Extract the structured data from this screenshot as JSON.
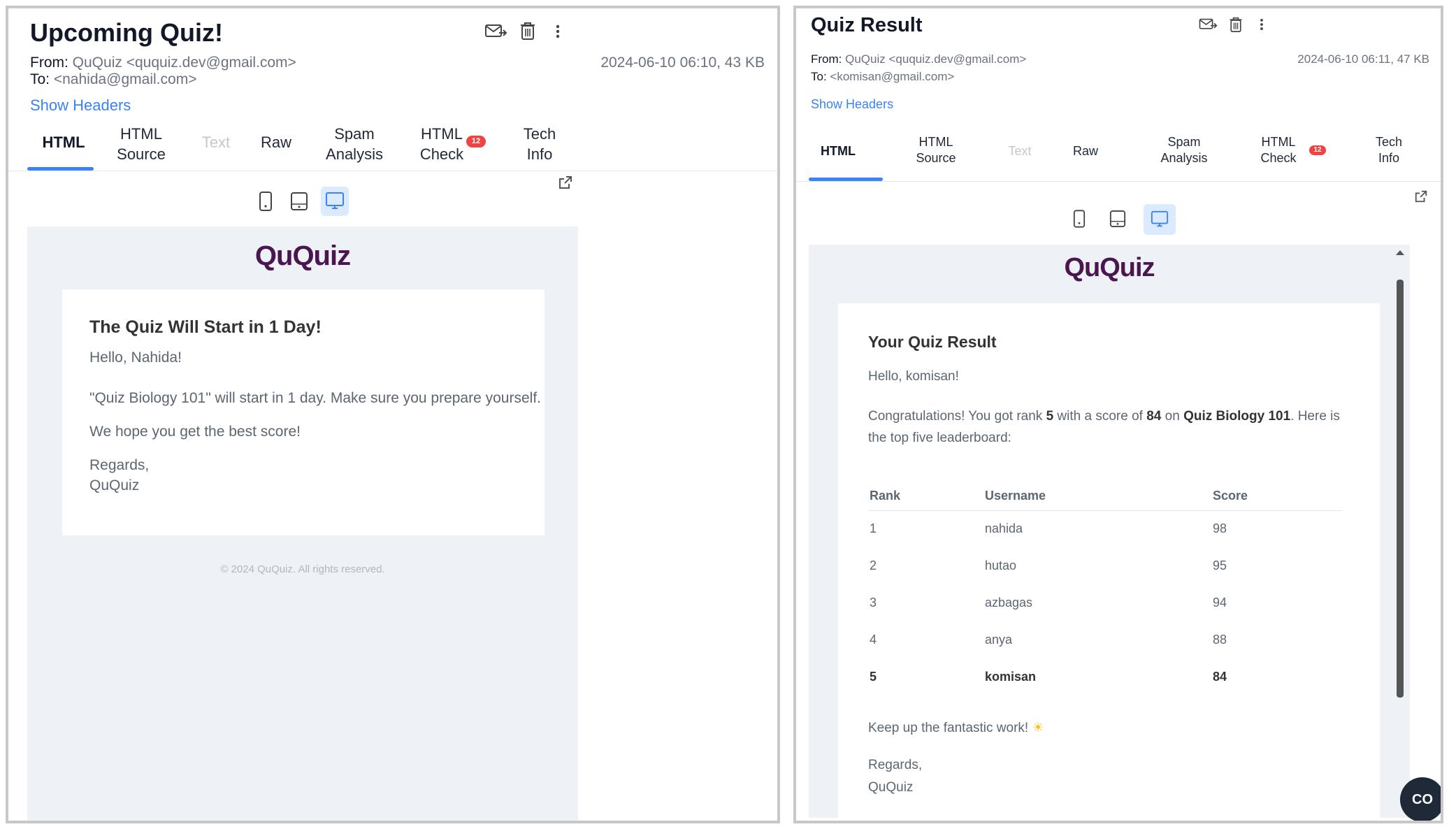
{
  "email_a": {
    "subject": "Upcoming Quiz!",
    "from_label": "From:",
    "from_value": "QuQuiz <ququiz.dev@gmail.com>",
    "to_label": "To:",
    "to_value": "<nahida@gmail.com>",
    "date_size": "2024-06-10 06:10, 43 KB",
    "show_headers": "Show Headers",
    "tabs": [
      {
        "line1": "HTML",
        "line2": ""
      },
      {
        "line1": "HTML",
        "line2": "Source"
      },
      {
        "line1": "Text",
        "line2": ""
      },
      {
        "line1": "Raw",
        "line2": ""
      },
      {
        "line1": "Spam",
        "line2": "Analysis"
      },
      {
        "line1": "HTML",
        "line2": "Check"
      },
      {
        "line1": "Tech",
        "line2": "Info"
      }
    ],
    "badge": "12",
    "logo": "QuQuiz",
    "card": {
      "title": "The Quiz Will Start in 1 Day!",
      "greeting": "Hello, Nahida!",
      "body": "\"Quiz Biology 101\" will start in 1 day. Make sure you prepare yourself.",
      "hope": "We hope you get the best score!",
      "regards": "Regards,",
      "signature": "QuQuiz"
    },
    "footer": "© 2024 QuQuiz. All rights reserved."
  },
  "email_b": {
    "subject": "Quiz Result",
    "from_label": "From:",
    "from_value": "QuQuiz <ququiz.dev@gmail.com>",
    "to_label": "To:",
    "to_value": "<komisan@gmail.com>",
    "date_size": "2024-06-10 06:11, 47 KB",
    "show_headers": "Show Headers",
    "tabs": [
      {
        "line1": "HTML",
        "line2": ""
      },
      {
        "line1": "HTML",
        "line2": "Source"
      },
      {
        "line1": "Text",
        "line2": ""
      },
      {
        "line1": "Raw",
        "line2": ""
      },
      {
        "line1": "Spam",
        "line2": "Analysis"
      },
      {
        "line1": "HTML",
        "line2": "Check"
      },
      {
        "line1": "Tech",
        "line2": "Info"
      }
    ],
    "badge": "12",
    "logo": "QuQuiz",
    "card": {
      "title": "Your Quiz Result",
      "greeting": "Hello, komisan!",
      "congrats_1": "Congratulations! You got rank ",
      "rank": "5",
      "congrats_2": " with a score of ",
      "score": "84",
      "congrats_3": " on ",
      "quiz_name": "Quiz Biology 101",
      "congrats_4": ". Here is the top five leaderboard:",
      "table_headers": [
        "Rank",
        "Username",
        "Score"
      ],
      "rows": [
        [
          "1",
          "nahida",
          "98"
        ],
        [
          "2",
          "hutao",
          "95"
        ],
        [
          "3",
          "azbagas",
          "94"
        ],
        [
          "4",
          "anya",
          "88"
        ],
        [
          "5",
          "komisan",
          "84"
        ]
      ],
      "keep_up": "Keep up the fantastic work!",
      "keep_up_emoji": "☀",
      "regards": "Regards,",
      "signature": "QuQuiz"
    },
    "fab_label": "CO"
  }
}
